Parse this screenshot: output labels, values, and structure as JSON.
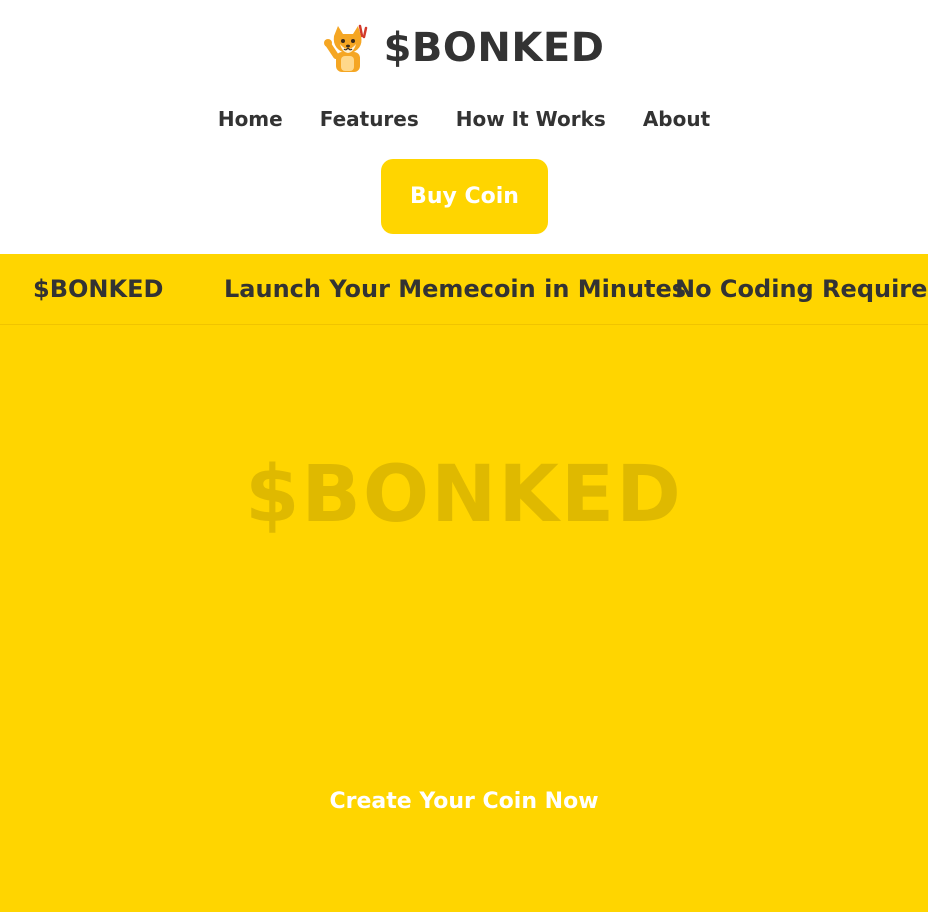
{
  "brand": {
    "name": "$BONKED",
    "mascot_icon": "shiba-mascot-icon"
  },
  "nav": {
    "items": [
      "Home",
      "Features",
      "How It Works",
      "About"
    ]
  },
  "header": {
    "buy_label": "Buy Coin"
  },
  "ticker": {
    "items": [
      "$BONKED",
      "Launch Your Memecoin in Minutes",
      "No Coding Required"
    ]
  },
  "hero": {
    "title": "$BONKED",
    "cta_label": "Create Your Coin Now"
  },
  "colors": {
    "accent": "#ffd500",
    "text": "#333333",
    "header_bg": "#ffffff"
  }
}
